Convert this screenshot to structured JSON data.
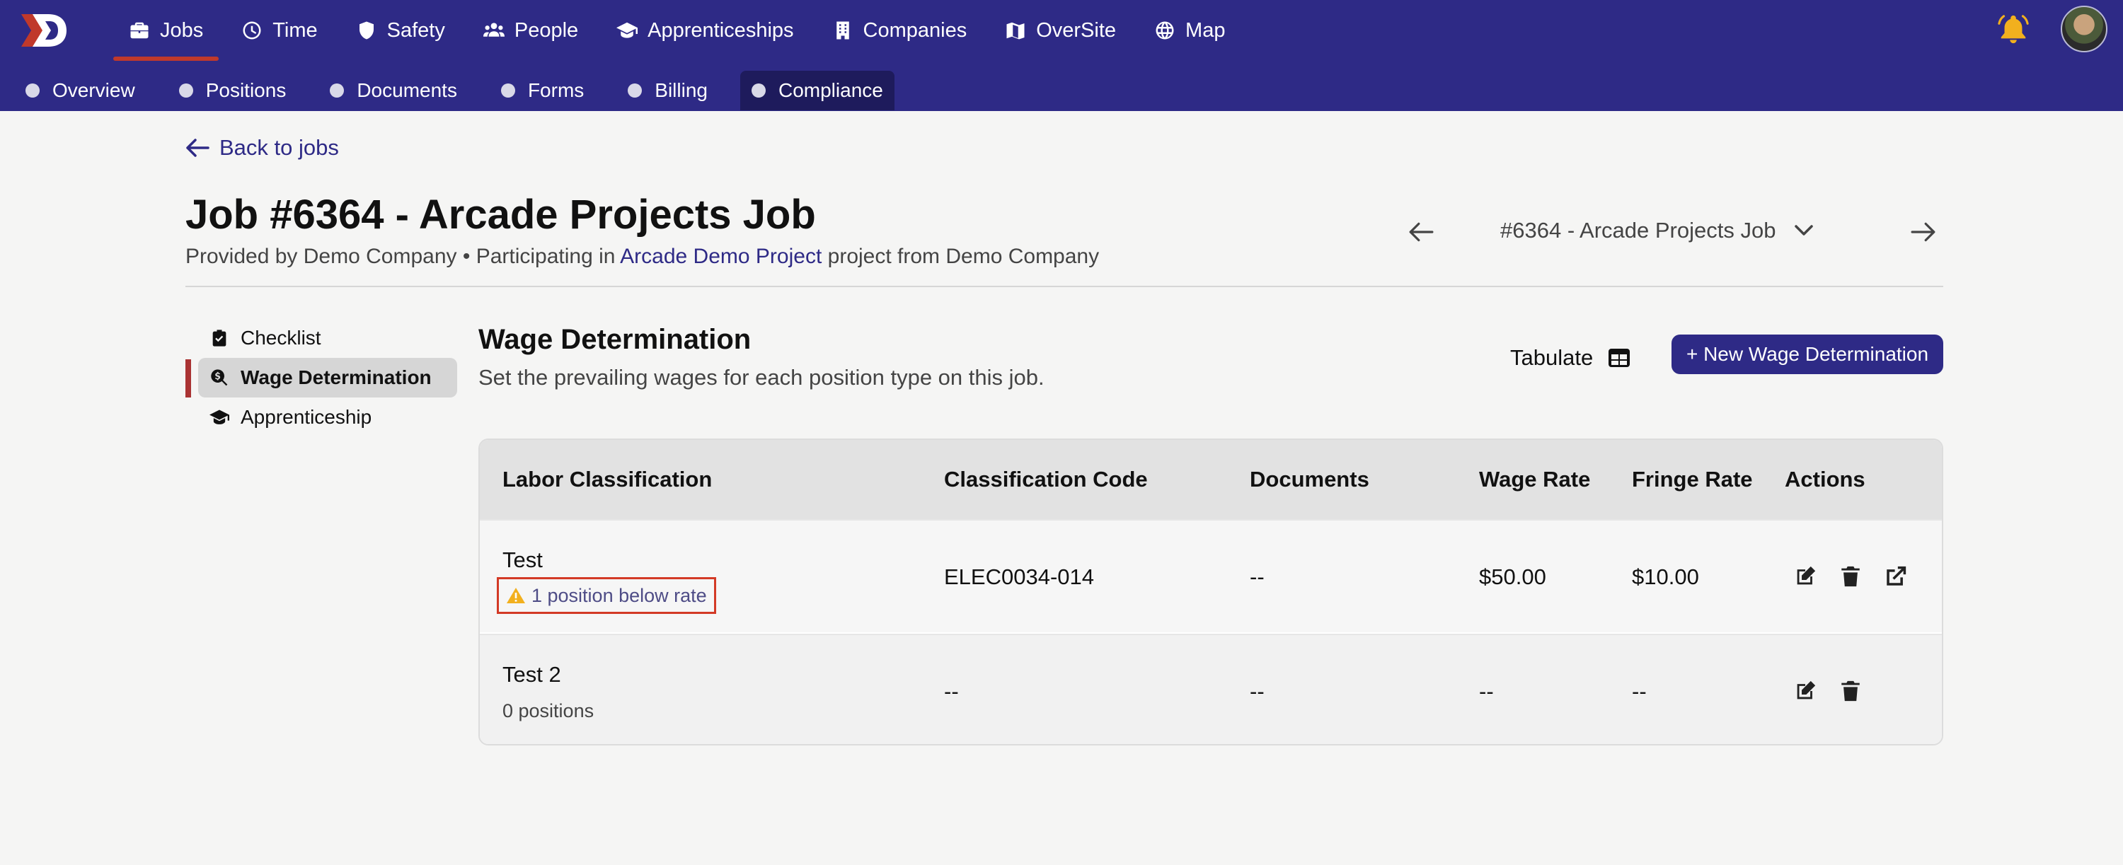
{
  "brand": {
    "accent": "#2e2a86",
    "warning": "#f2b01e",
    "active_bar": "#c0392b"
  },
  "main_nav": [
    {
      "label": "Jobs",
      "icon": "briefcase-icon"
    },
    {
      "label": "Time",
      "icon": "clock-icon"
    },
    {
      "label": "Safety",
      "icon": "shield-icon"
    },
    {
      "label": "People",
      "icon": "people-icon"
    },
    {
      "label": "Apprenticeships",
      "icon": "graduation-cap-icon"
    },
    {
      "label": "Companies",
      "icon": "building-icon"
    },
    {
      "label": "OverSite",
      "icon": "map-fold-icon"
    },
    {
      "label": "Map",
      "icon": "globe-icon"
    }
  ],
  "sub_nav": [
    "Overview",
    "Positions",
    "Documents",
    "Forms",
    "Billing",
    "Compliance"
  ],
  "back_link": "Back to jobs",
  "job": {
    "title": "Job #6364 - Arcade Projects Job",
    "provided_by": "Provided by Demo Company",
    "participating_prefix": "Participating in",
    "project_link": "Arcade Demo Project",
    "participating_suffix": "project from Demo Company",
    "selector": "#6364 - Arcade Projects Job"
  },
  "side_menu": [
    "Checklist",
    "Wage Determination",
    "Apprenticeship"
  ],
  "section": {
    "title": "Wage Determination",
    "subtitle": "Set the prevailing wages for each position type on this job.",
    "tabulate": "Tabulate",
    "new_button": "+ New Wage Determination"
  },
  "table": {
    "headers": [
      "Labor Classification",
      "Classification Code",
      "Documents",
      "Wage Rate",
      "Fringe Rate",
      "Actions"
    ],
    "rows": [
      {
        "name": "Test",
        "note": "1 position below rate",
        "code": "ELEC0034-014",
        "documents": "--",
        "wage": "$50.00",
        "fringe": "$10.00"
      },
      {
        "name": "Test 2",
        "note": "0 positions",
        "code": "--",
        "documents": "--",
        "wage": "--",
        "fringe": "--"
      }
    ]
  }
}
